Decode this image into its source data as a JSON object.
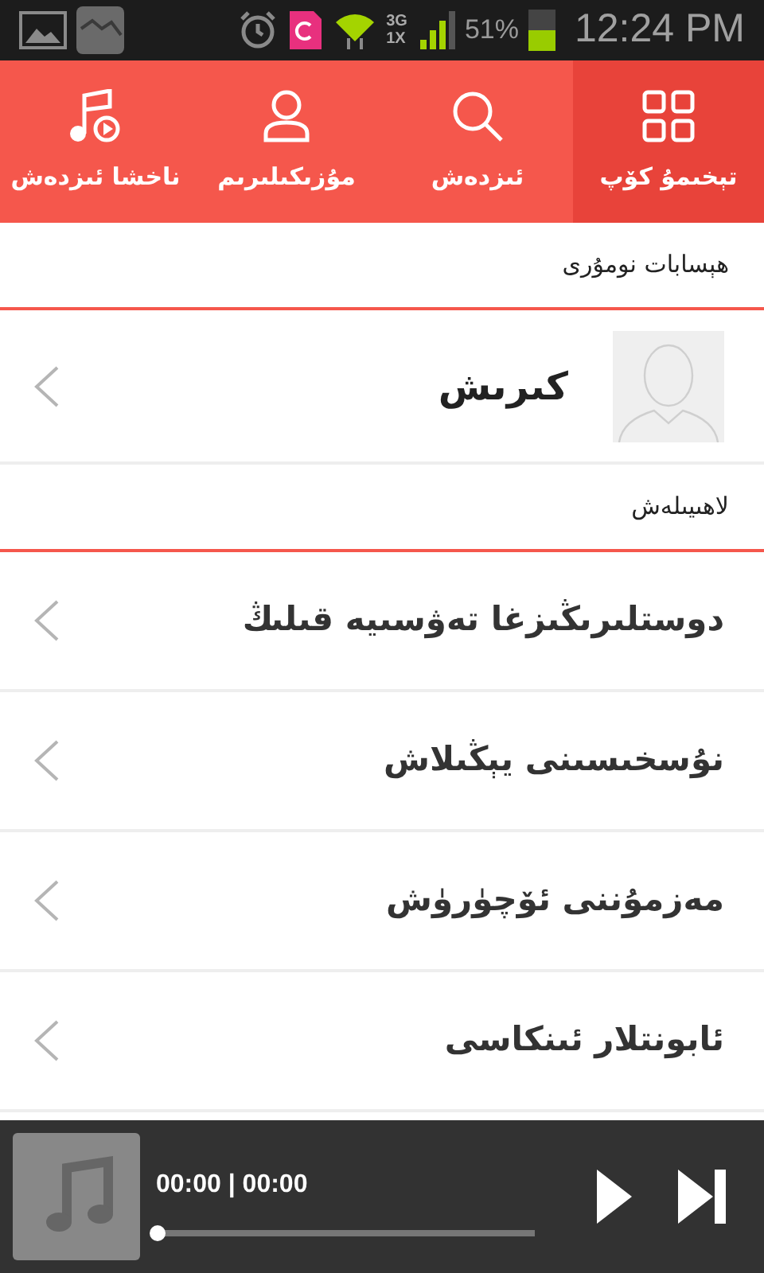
{
  "status_bar": {
    "network_top": "3G",
    "network_bottom": "1X",
    "battery": "51%",
    "time": "12:24 PM"
  },
  "tabs": [
    {
      "label": "تېخىمۇ كۆپ",
      "kind": "grid",
      "selected": true
    },
    {
      "label": "ئىزدەش",
      "kind": "search",
      "selected": false
    },
    {
      "label": "مۇزىكىلىرىم",
      "kind": "person",
      "selected": false
    },
    {
      "label": "ناخشا ئىزدەش",
      "kind": "music",
      "selected": false
    }
  ],
  "account_section": {
    "title": "ھېسابات نومۇرى",
    "login": "كىرىش"
  },
  "design_section": {
    "title": "لاھىيىلەش",
    "items": [
      {
        "label": "دوستلىرىڭىزغا تەۋسىيە قىلىڭ"
      },
      {
        "label": "نۇسخىسىنى يېڭىلاش"
      },
      {
        "label": "مەزمۇننى ئۆچۈرۈش"
      },
      {
        "label": "ئابونتلار ئىنكاسى"
      }
    ]
  },
  "player": {
    "time": "00:00 | 00:00",
    "level": 0
  }
}
